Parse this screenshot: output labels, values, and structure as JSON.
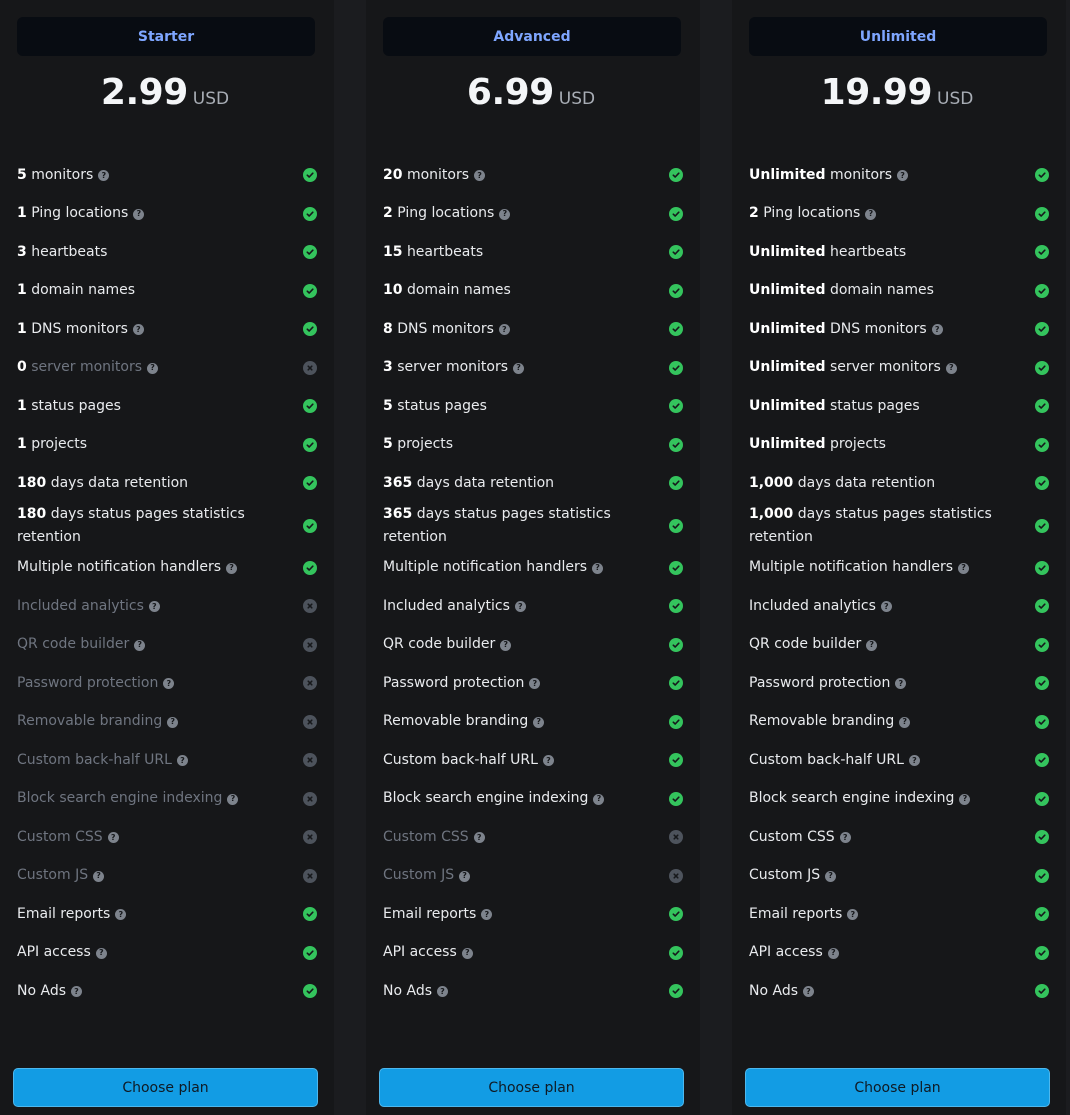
{
  "colors": {
    "page_bg": "#1b1c1f",
    "card_bg": "#161719",
    "header_bg": "#080c12",
    "plan_name": "#7ea6ff",
    "check_green": "#34c45d",
    "cross_gray": "#4d535c",
    "button_bg": "#129ce4"
  },
  "icons": {
    "help": "question-circle-icon",
    "included": "check-circle-icon",
    "excluded": "x-circle-icon"
  },
  "plans": [
    {
      "name": "Starter",
      "price": "2.99",
      "currency": "USD",
      "button_label": "Choose plan",
      "features": [
        {
          "value": "5",
          "label": "monitors",
          "help": true,
          "included": true
        },
        {
          "value": "1",
          "label": "Ping locations",
          "help": true,
          "included": true
        },
        {
          "value": "3",
          "label": "heartbeats",
          "help": false,
          "included": true
        },
        {
          "value": "1",
          "label": "domain names",
          "help": false,
          "included": true
        },
        {
          "value": "1",
          "label": "DNS monitors",
          "help": true,
          "included": true
        },
        {
          "value": "0",
          "label": "server monitors",
          "help": true,
          "included": false
        },
        {
          "value": "1",
          "label": "status pages",
          "help": false,
          "included": true
        },
        {
          "value": "1",
          "label": "projects",
          "help": false,
          "included": true
        },
        {
          "value": "180",
          "label": "days data retention",
          "help": false,
          "included": true
        },
        {
          "value": "180",
          "label": "days status pages statistics retention",
          "help": false,
          "included": true
        },
        {
          "value": "",
          "label": "Multiple notification handlers",
          "help": true,
          "included": true
        },
        {
          "value": "",
          "label": "Included analytics",
          "help": true,
          "included": false
        },
        {
          "value": "",
          "label": "QR code builder",
          "help": true,
          "included": false
        },
        {
          "value": "",
          "label": "Password protection",
          "help": true,
          "included": false
        },
        {
          "value": "",
          "label": "Removable branding",
          "help": true,
          "included": false
        },
        {
          "value": "",
          "label": "Custom back-half URL",
          "help": true,
          "included": false
        },
        {
          "value": "",
          "label": "Block search engine indexing",
          "help": true,
          "included": false
        },
        {
          "value": "",
          "label": "Custom CSS",
          "help": true,
          "included": false
        },
        {
          "value": "",
          "label": "Custom JS",
          "help": true,
          "included": false
        },
        {
          "value": "",
          "label": "Email reports",
          "help": true,
          "included": true
        },
        {
          "value": "",
          "label": "API access",
          "help": true,
          "included": true
        },
        {
          "value": "",
          "label": "No Ads",
          "help": true,
          "included": true
        }
      ]
    },
    {
      "name": "Advanced",
      "price": "6.99",
      "currency": "USD",
      "button_label": "Choose plan",
      "features": [
        {
          "value": "20",
          "label": "monitors",
          "help": true,
          "included": true
        },
        {
          "value": "2",
          "label": "Ping locations",
          "help": true,
          "included": true
        },
        {
          "value": "15",
          "label": "heartbeats",
          "help": false,
          "included": true
        },
        {
          "value": "10",
          "label": "domain names",
          "help": false,
          "included": true
        },
        {
          "value": "8",
          "label": "DNS monitors",
          "help": true,
          "included": true
        },
        {
          "value": "3",
          "label": "server monitors",
          "help": true,
          "included": true
        },
        {
          "value": "5",
          "label": "status pages",
          "help": false,
          "included": true
        },
        {
          "value": "5",
          "label": "projects",
          "help": false,
          "included": true
        },
        {
          "value": "365",
          "label": "days data retention",
          "help": false,
          "included": true
        },
        {
          "value": "365",
          "label": "days status pages statistics retention",
          "help": false,
          "included": true
        },
        {
          "value": "",
          "label": "Multiple notification handlers",
          "help": true,
          "included": true
        },
        {
          "value": "",
          "label": "Included analytics",
          "help": true,
          "included": true
        },
        {
          "value": "",
          "label": "QR code builder",
          "help": true,
          "included": true
        },
        {
          "value": "",
          "label": "Password protection",
          "help": true,
          "included": true
        },
        {
          "value": "",
          "label": "Removable branding",
          "help": true,
          "included": true
        },
        {
          "value": "",
          "label": "Custom back-half URL",
          "help": true,
          "included": true
        },
        {
          "value": "",
          "label": "Block search engine indexing",
          "help": true,
          "included": true
        },
        {
          "value": "",
          "label": "Custom CSS",
          "help": true,
          "included": false
        },
        {
          "value": "",
          "label": "Custom JS",
          "help": true,
          "included": false
        },
        {
          "value": "",
          "label": "Email reports",
          "help": true,
          "included": true
        },
        {
          "value": "",
          "label": "API access",
          "help": true,
          "included": true
        },
        {
          "value": "",
          "label": "No Ads",
          "help": true,
          "included": true
        }
      ]
    },
    {
      "name": "Unlimited",
      "price": "19.99",
      "currency": "USD",
      "button_label": "Choose plan",
      "features": [
        {
          "value": "Unlimited",
          "label": "monitors",
          "help": true,
          "included": true
        },
        {
          "value": "2",
          "label": "Ping locations",
          "help": true,
          "included": true
        },
        {
          "value": "Unlimited",
          "label": "heartbeats",
          "help": false,
          "included": true
        },
        {
          "value": "Unlimited",
          "label": "domain names",
          "help": false,
          "included": true
        },
        {
          "value": "Unlimited",
          "label": "DNS monitors",
          "help": true,
          "included": true
        },
        {
          "value": "Unlimited",
          "label": "server monitors",
          "help": true,
          "included": true
        },
        {
          "value": "Unlimited",
          "label": "status pages",
          "help": false,
          "included": true
        },
        {
          "value": "Unlimited",
          "label": "projects",
          "help": false,
          "included": true
        },
        {
          "value": "1,000",
          "label": "days data retention",
          "help": false,
          "included": true
        },
        {
          "value": "1,000",
          "label": "days status pages statistics retention",
          "help": false,
          "included": true
        },
        {
          "value": "",
          "label": "Multiple notification handlers",
          "help": true,
          "included": true
        },
        {
          "value": "",
          "label": "Included analytics",
          "help": true,
          "included": true
        },
        {
          "value": "",
          "label": "QR code builder",
          "help": true,
          "included": true
        },
        {
          "value": "",
          "label": "Password protection",
          "help": true,
          "included": true
        },
        {
          "value": "",
          "label": "Removable branding",
          "help": true,
          "included": true
        },
        {
          "value": "",
          "label": "Custom back-half URL",
          "help": true,
          "included": true
        },
        {
          "value": "",
          "label": "Block search engine indexing",
          "help": true,
          "included": true
        },
        {
          "value": "",
          "label": "Custom CSS",
          "help": true,
          "included": true
        },
        {
          "value": "",
          "label": "Custom JS",
          "help": true,
          "included": true
        },
        {
          "value": "",
          "label": "Email reports",
          "help": true,
          "included": true
        },
        {
          "value": "",
          "label": "API access",
          "help": true,
          "included": true
        },
        {
          "value": "",
          "label": "No Ads",
          "help": true,
          "included": true
        }
      ]
    }
  ]
}
